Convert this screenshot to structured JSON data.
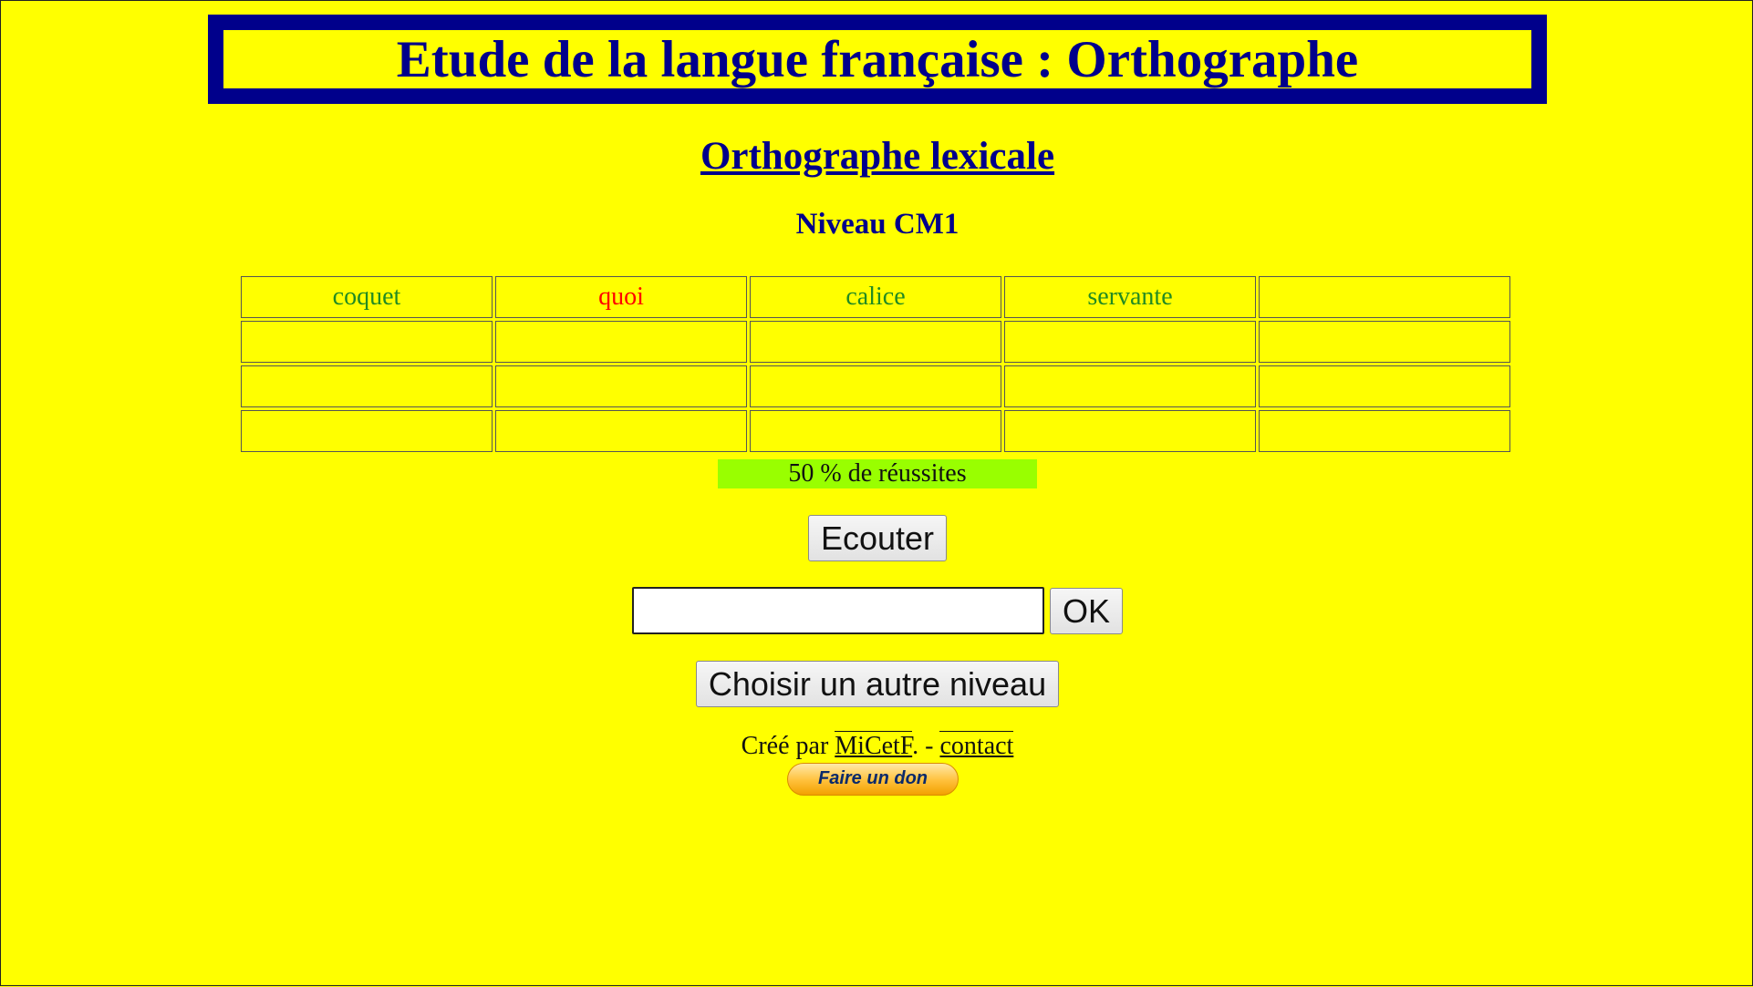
{
  "header": {
    "title": "Etude de la langue française : Orthographe"
  },
  "subtitle": "Orthographe lexicale",
  "level": "Niveau CM1",
  "colors": {
    "background": "#ffff00",
    "title": "#00008b",
    "correct": "#228b22",
    "wrong": "#ff0000",
    "progress": "#99ff00"
  },
  "grid": {
    "rows": [
      [
        {
          "text": "coquet",
          "status": "correct"
        },
        {
          "text": "quoi",
          "status": "wrong"
        },
        {
          "text": "calice",
          "status": "correct"
        },
        {
          "text": "servante",
          "status": "correct"
        },
        {
          "text": "",
          "status": ""
        }
      ],
      [
        {
          "text": "",
          "status": ""
        },
        {
          "text": "",
          "status": ""
        },
        {
          "text": "",
          "status": ""
        },
        {
          "text": "",
          "status": ""
        },
        {
          "text": "",
          "status": ""
        }
      ],
      [
        {
          "text": "",
          "status": ""
        },
        {
          "text": "",
          "status": ""
        },
        {
          "text": "",
          "status": ""
        },
        {
          "text": "",
          "status": ""
        },
        {
          "text": "",
          "status": ""
        }
      ],
      [
        {
          "text": "",
          "status": ""
        },
        {
          "text": "",
          "status": ""
        },
        {
          "text": "",
          "status": ""
        },
        {
          "text": "",
          "status": ""
        },
        {
          "text": "",
          "status": ""
        }
      ]
    ]
  },
  "progress": {
    "label": "50 % de réussites"
  },
  "buttons": {
    "listen": "Ecouter",
    "ok": "OK",
    "other_level": "Choisir un autre niveau"
  },
  "answer_input": {
    "value": "",
    "placeholder": ""
  },
  "footer": {
    "prefix": "Créé par ",
    "author_link": "MiCetF",
    "separator": ". - ",
    "contact_link": "contact",
    "donate": "Faire un don"
  }
}
